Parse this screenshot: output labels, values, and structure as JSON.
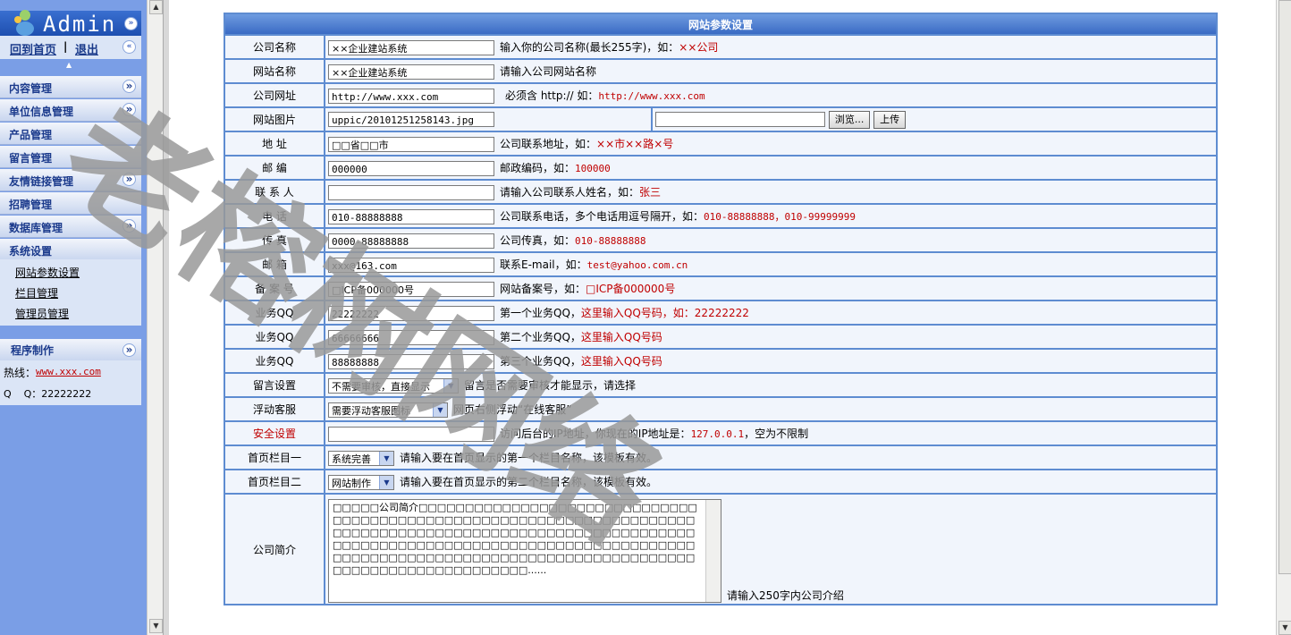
{
  "sidebar": {
    "title": "Admin",
    "home_link": "回到首页",
    "separator": "|",
    "logout_link": "退出",
    "menus": [
      {
        "label": "内容管理"
      },
      {
        "label": "单位信息管理"
      },
      {
        "label": "产品管理"
      },
      {
        "label": "留言管理"
      },
      {
        "label": "友情链接管理"
      },
      {
        "label": "招聘管理"
      },
      {
        "label": "数据库管理"
      },
      {
        "label": "系统设置"
      }
    ],
    "system_sub": [
      "网站参数设置",
      "栏目管理",
      "管理员管理"
    ],
    "program": {
      "title": "程序制作",
      "hotline_label": "热线：",
      "hotline_link": "www.xxx.com",
      "qq_text": "Q    Q：22222222"
    }
  },
  "form": {
    "title": "网站参数设置",
    "rows": {
      "company_name": {
        "label": "公司名称",
        "value": "××企业建站系统",
        "hint": "输入你的公司名称(最长255字)，如：",
        "example": "××公司"
      },
      "site_name": {
        "label": "网站名称",
        "value": "××企业建站系统",
        "hint": "请输入公司网站名称"
      },
      "company_url": {
        "label": "公司网址",
        "value": "http://www.xxx.com",
        "hint": "必须含 http:// 如：",
        "example": "http://www.xxx.com"
      },
      "site_image": {
        "label": "网站图片",
        "value": "uppic/20101251258143.jpg",
        "browse": "浏览...",
        "upload": "上传"
      },
      "address": {
        "label": "地    址",
        "value": "□□省□□市",
        "hint": "公司联系地址，如：",
        "example": "××市××路×号"
      },
      "postcode": {
        "label": "邮    编",
        "value": "000000",
        "hint": "邮政编码，如：",
        "example": "100000"
      },
      "contact": {
        "label": "联 系 人",
        "value": "",
        "hint": "请输入公司联系人姓名，如：",
        "example": "张三"
      },
      "phone": {
        "label": "电    话",
        "value": "010-88888888",
        "hint": "公司联系电话，多个电话用逗号隔开，如：",
        "example": "010-88888888，010-99999999"
      },
      "fax": {
        "label": "传    真",
        "value": "0000-88888888",
        "hint": "公司传真，如：",
        "example": "010-88888888"
      },
      "email": {
        "label": "邮    箱",
        "value": "xxx@163.com",
        "hint": "联系E-mail，如：",
        "example": "test@yahoo.com.cn"
      },
      "icp": {
        "label": "备 案 号",
        "value": "□ICP备000000号",
        "hint": "网站备案号，如：",
        "example": "□ICP备000000号"
      },
      "qq1": {
        "label": "业务QQ",
        "value": "22222222",
        "hint": "第一个业务QQ，",
        "example": "这里输入QQ号码，如：22222222"
      },
      "qq2": {
        "label": "业务QQ",
        "value": "66666666",
        "hint": "第二个业务QQ，",
        "example": "这里输入QQ号码"
      },
      "qq3": {
        "label": "业务QQ",
        "value": "88888888",
        "hint": "第三个业务QQ，",
        "example": "这里输入QQ号码"
      },
      "message": {
        "label": "留言设置",
        "value": "不需要审核，直接显示",
        "hint": "留言是否需要审核才能显示，请选择"
      },
      "float_service": {
        "label": "浮动客服",
        "value": "需要浮动客服图标",
        "hint": "网页右侧浮动“在线客服”"
      },
      "security": {
        "label": "安全设置",
        "value": "",
        "hint": "访问后台的IP地址，你现在的IP地址是：",
        "example": "127.0.0.1",
        "hint2": "，空为不限制"
      },
      "home_col1": {
        "label": "首页栏目一",
        "value": "系统完善",
        "hint": "请输入要在首页显示的第一个栏目名称，该模板有效。"
      },
      "home_col2": {
        "label": "首页栏目二",
        "value": "网站制作",
        "hint": "请输入要在首页显示的第二个栏目名称，该模板有效。"
      },
      "intro": {
        "label": "公司简介",
        "value": "□□□□□公司简介□□□□□□□□□□□□□□□□□□□□□□□□□□□□□□□□□□□□□□□□□□□□□□□□□□□□□□□□□□□□□□□□□□□□□□□□□□□□□□□□□□□□□□□□□□□□□□□□□□□□□□□□□□□□□□□□□□□□□□□□□□□□□□□□□□□□□□□□□□□□□□□□□□□□□□□□□□□□□□□□□□□□□□□□□□□□□□□□□□□□□□□□□□□□□□□□□□□□□□□□□□□□□□□......",
        "hint": "请输入250字内公司介绍"
      }
    }
  },
  "watermark": "老榕树网络",
  "colors": {
    "sidebar_bg": "#7a9ee6",
    "table_border": "#5e8cd1",
    "hint_red": "#c00000"
  }
}
